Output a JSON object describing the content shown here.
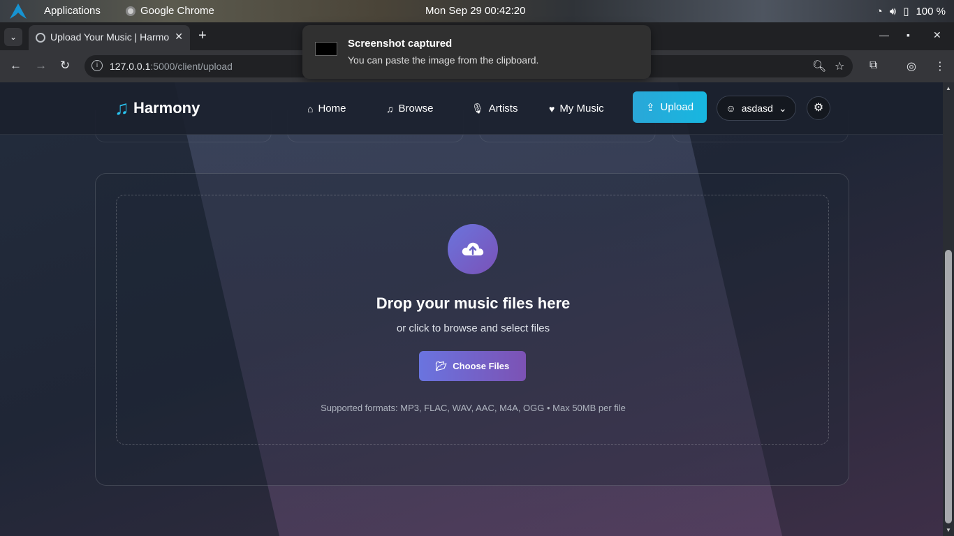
{
  "os": {
    "applications": "Applications",
    "active_app": "Google Chrome",
    "clock": "Mon Sep 29  00:42:20",
    "battery": "100 %"
  },
  "browser": {
    "tab_title": "Upload Your Music | Harmony",
    "url_host": "127.0.0.1",
    "url_path": ":5000/client/upload"
  },
  "notification": {
    "title": "Screenshot captured",
    "body": "You can paste the image from the clipboard."
  },
  "navbar": {
    "brand": "Harmony",
    "links": [
      {
        "label": "Home",
        "icon": "home-icon"
      },
      {
        "label": "Browse",
        "icon": "music-note-icon"
      },
      {
        "label": "Artists",
        "icon": "microphone-icon"
      },
      {
        "label": "My Music",
        "icon": "heart-icon"
      }
    ],
    "upload_label": "Upload",
    "username": "asdasd",
    "accent": "#1fb3e0"
  },
  "upload": {
    "title": "Drop your music files here",
    "subtitle": "or click to browse and select files",
    "button": "Choose Files",
    "formats": "Supported formats: MP3, FLAC, WAV, AAC, M4A, OGG • Max 50MB per file",
    "button_color_start": "#6a74df",
    "button_color_end": "#7c52b4"
  }
}
